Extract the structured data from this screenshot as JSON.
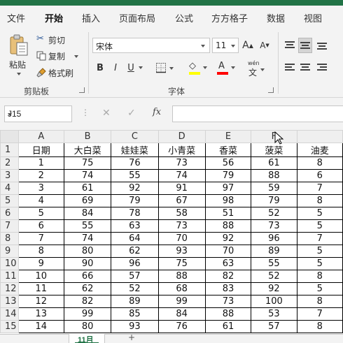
{
  "ribbon_tabs": [
    "文件",
    "开始",
    "插入",
    "页面布局",
    "公式",
    "方方格子",
    "数据",
    "视图"
  ],
  "clipboard": {
    "paste_label": "粘贴",
    "cut_label": "剪切",
    "copy_label": "复制",
    "format_painter_label": "格式刷",
    "group_label": "剪贴板"
  },
  "font": {
    "name": "宋体",
    "size": "11",
    "group_label": "字体",
    "bold": "B",
    "italic": "I",
    "underline": "U",
    "grow": "A",
    "shrink": "A",
    "fill_color": "#ffff00",
    "font_color": "#ff0000",
    "phonetic": "wén"
  },
  "formula_bar": {
    "name_box": "J15",
    "cancel": "✕",
    "enter": "✓",
    "fx": "fx",
    "content": ""
  },
  "sheet": {
    "columns": [
      "A",
      "B",
      "C",
      "D",
      "E",
      "F",
      ""
    ],
    "rows": [
      {
        "num": "1",
        "cells": [
          "日期",
          "大白菜",
          "娃娃菜",
          "小青菜",
          "香菜",
          "菠菜",
          "油麦"
        ]
      },
      {
        "num": "2",
        "cells": [
          "1",
          "75",
          "76",
          "73",
          "56",
          "61",
          "8"
        ]
      },
      {
        "num": "3",
        "cells": [
          "2",
          "74",
          "55",
          "74",
          "79",
          "88",
          "6"
        ]
      },
      {
        "num": "4",
        "cells": [
          "3",
          "61",
          "92",
          "91",
          "97",
          "59",
          "7"
        ]
      },
      {
        "num": "5",
        "cells": [
          "4",
          "69",
          "79",
          "67",
          "98",
          "79",
          "8"
        ]
      },
      {
        "num": "6",
        "cells": [
          "5",
          "84",
          "78",
          "58",
          "51",
          "52",
          "5"
        ]
      },
      {
        "num": "7",
        "cells": [
          "6",
          "55",
          "63",
          "73",
          "88",
          "73",
          "5"
        ]
      },
      {
        "num": "8",
        "cells": [
          "7",
          "74",
          "64",
          "70",
          "92",
          "96",
          "7"
        ]
      },
      {
        "num": "9",
        "cells": [
          "8",
          "80",
          "62",
          "93",
          "70",
          "89",
          "5"
        ]
      },
      {
        "num": "10",
        "cells": [
          "9",
          "90",
          "96",
          "75",
          "63",
          "55",
          "5"
        ]
      },
      {
        "num": "11",
        "cells": [
          "10",
          "66",
          "57",
          "88",
          "82",
          "52",
          "8"
        ]
      },
      {
        "num": "12",
        "cells": [
          "11",
          "62",
          "52",
          "68",
          "83",
          "92",
          "5"
        ]
      },
      {
        "num": "13",
        "cells": [
          "12",
          "82",
          "89",
          "99",
          "73",
          "100",
          "8"
        ]
      },
      {
        "num": "14",
        "cells": [
          "13",
          "99",
          "85",
          "84",
          "88",
          "53",
          "7"
        ]
      },
      {
        "num": "15",
        "cells": [
          "14",
          "80",
          "93",
          "76",
          "61",
          "57",
          "8"
        ]
      }
    ]
  },
  "sheet_tabs": {
    "active": "11月",
    "add": "+"
  }
}
